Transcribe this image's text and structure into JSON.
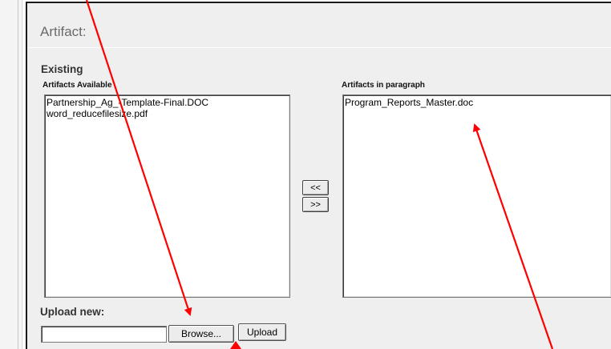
{
  "section": {
    "title": "Artifact:",
    "existing_label": "Existing"
  },
  "available": {
    "label": "Artifacts Available",
    "items": [
      "Partnership_Ag_-Template-Final.DOC",
      "word_reducefilesize.pdf"
    ]
  },
  "in_paragraph": {
    "label": "Artifacts in paragraph",
    "items": [
      "Program_Reports_Master.doc"
    ]
  },
  "transfer": {
    "to_available_label": "<<",
    "to_paragraph_label": ">>"
  },
  "upload": {
    "label": "Upload new:",
    "file_value": "",
    "browse_label": "Browse...",
    "upload_label": "Upload"
  },
  "colors": {
    "annotation_arrow": "#ff0000",
    "panel_background": "#efefef"
  },
  "icons": {
    "arrows": "red-annotation-arrow"
  }
}
